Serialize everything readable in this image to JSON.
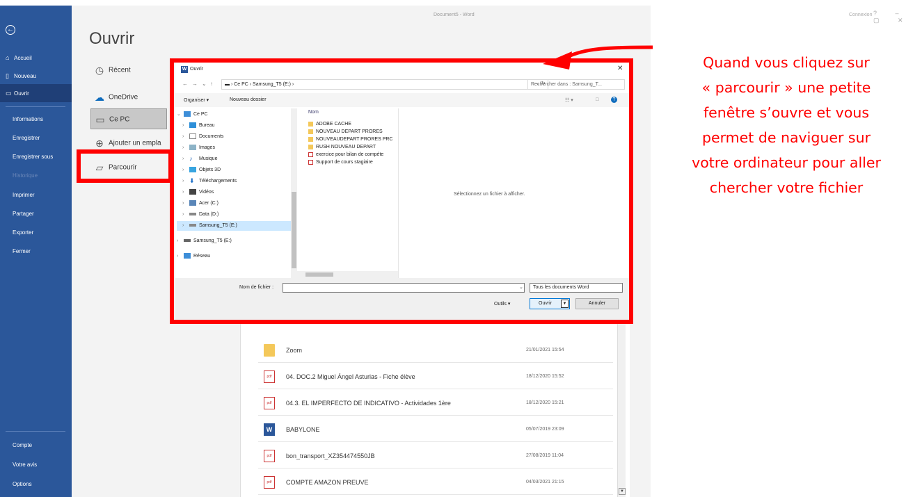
{
  "window": {
    "doc_title": "Document5  -  Word",
    "connexion": "Connexion",
    "controls": "?  –  ▢  ✕"
  },
  "sidebar": {
    "back_icon": "back-arrow-icon",
    "items": [
      {
        "label": "Accueil",
        "icon": "home-icon"
      },
      {
        "label": "Nouveau",
        "icon": "new-doc-icon"
      },
      {
        "label": "Ouvrir",
        "icon": "open-folder-icon"
      },
      {
        "label": "Informations"
      },
      {
        "label": "Enregistrer"
      },
      {
        "label": "Enregistrer sous"
      },
      {
        "label": "Historique"
      },
      {
        "label": "Imprimer"
      },
      {
        "label": "Partager"
      },
      {
        "label": "Exporter"
      },
      {
        "label": "Fermer"
      },
      {
        "label": "Compte"
      },
      {
        "label": "Votre avis"
      },
      {
        "label": "Options"
      }
    ]
  },
  "main": {
    "heading": "Ouvrir",
    "locations": [
      {
        "label": "Récent",
        "icon": "clock-icon"
      },
      {
        "label": "OneDrive",
        "icon": "cloud-icon"
      },
      {
        "label": "Ce PC",
        "icon": "computer-icon"
      },
      {
        "label": "Ajouter un empla",
        "icon": "globe-icon"
      },
      {
        "label": "Parcourir",
        "icon": "folder-icon"
      }
    ],
    "files": [
      {
        "name": "Zoom",
        "date": "21/01/2021 15:54",
        "kind": "folder"
      },
      {
        "name": "04. DOC.2 Miguel Ángel Asturias - Fiche élève",
        "date": "18/12/2020 15:52",
        "kind": "pdf"
      },
      {
        "name": "04.3. EL IMPERFECTO DE INDICATIVO - Actividades 1ère",
        "date": "18/12/2020 15:21",
        "kind": "pdf"
      },
      {
        "name": "BABYLONE",
        "date": "05/07/2019 23:09",
        "kind": "word"
      },
      {
        "name": "bon_transport_XZ354474550JB",
        "date": "27/08/2019 11:04",
        "kind": "pdf"
      },
      {
        "name": "COMPTE AMAZON PREUVE",
        "date": "04/03/2021 21:15",
        "kind": "pdf"
      }
    ]
  },
  "dialog": {
    "title": "Ouvrir",
    "close": "✕",
    "address": "▬  ›  Ce PC  ›  Samsung_T5 (E:)  ›",
    "search_placeholder": "Rechercher dans : Samsung_T...",
    "organise": "Organiser ▾",
    "new_folder": "Nouveau dossier",
    "tree": [
      {
        "label": "Ce PC",
        "level": 0,
        "expanded": true
      },
      {
        "label": "Bureau",
        "level": 1
      },
      {
        "label": "Documents",
        "level": 1
      },
      {
        "label": "Images",
        "level": 1
      },
      {
        "label": "Musique",
        "level": 1
      },
      {
        "label": "Objets 3D",
        "level": 1
      },
      {
        "label": "Téléchargements",
        "level": 1
      },
      {
        "label": "Vidéos",
        "level": 1
      },
      {
        "label": "Acer (C:)",
        "level": 1
      },
      {
        "label": "Data (D:)",
        "level": 1
      },
      {
        "label": "Samsung_T5 (E:)",
        "level": 1,
        "selected": true
      },
      {
        "label": "Samsung_T5 (E:)",
        "level": 0
      },
      {
        "label": "Réseau",
        "level": 0
      }
    ],
    "column_name": "Nom",
    "list": [
      {
        "name": "ADOBE CACHE",
        "kind": "folder"
      },
      {
        "name": "NOUVEAU DEPART PRORES",
        "kind": "folder"
      },
      {
        "name": "NOUVEAUDEPART PRORES PRC",
        "kind": "folder"
      },
      {
        "name": "RUSH NOUVEAU DEPART",
        "kind": "folder"
      },
      {
        "name": "exercice pour bilan de compéte",
        "kind": "pdf"
      },
      {
        "name": "Support de cours stagiaire",
        "kind": "pdf"
      }
    ],
    "preview": "Sélectionnez un fichier à afficher.",
    "filename_label": "Nom de fichier :",
    "filename_value": "",
    "filetype": "Tous les documents Word",
    "tools": "Outils  ▾",
    "open": "Ouvrir",
    "cancel": "Annuler"
  },
  "annotation": {
    "lines": [
      "Quand vous cliquez sur",
      "« parcourir » une petite",
      "fenêtre s’ouvre et vous",
      "permet de naviguer sur",
      "votre ordinateur pour aller",
      "chercher votre fichier"
    ]
  },
  "colors": {
    "accent": "#2b579a",
    "highlight": "#ff0000"
  }
}
